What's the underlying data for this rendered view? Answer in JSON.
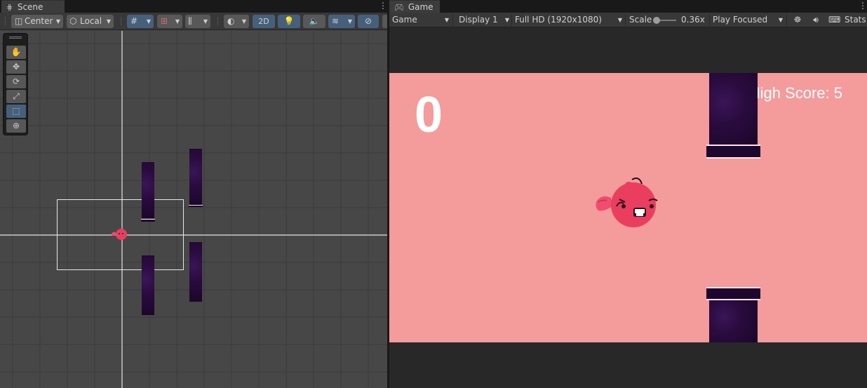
{
  "scene": {
    "tab": {
      "label": "Scene",
      "icon": "grid-icon"
    },
    "toolbar": {
      "pivot": "Center",
      "space": "Local",
      "mode_2d": "2D"
    },
    "tools": [
      "hand-tool",
      "move-tool",
      "rotate-tool",
      "scale-tool",
      "rect-tool",
      "transform-tool"
    ],
    "active_tool": "rect-tool"
  },
  "game": {
    "tab": {
      "label": "Game",
      "icon": "gamepad-icon"
    },
    "toolbar": {
      "view": "Game",
      "display": "Display 1",
      "resolution": "Full HD (1920x1080)",
      "scale_label": "Scale",
      "scale_value": "0.36x",
      "play_mode": "Play Focused",
      "stats": "Stats"
    },
    "score": "0",
    "high_score": "High Score: 5"
  },
  "colors": {
    "game_bg": "#f49b9b",
    "pipe": "#2a0b3f",
    "bird": "#ea3e5f",
    "accent_blue": "#46607c"
  }
}
